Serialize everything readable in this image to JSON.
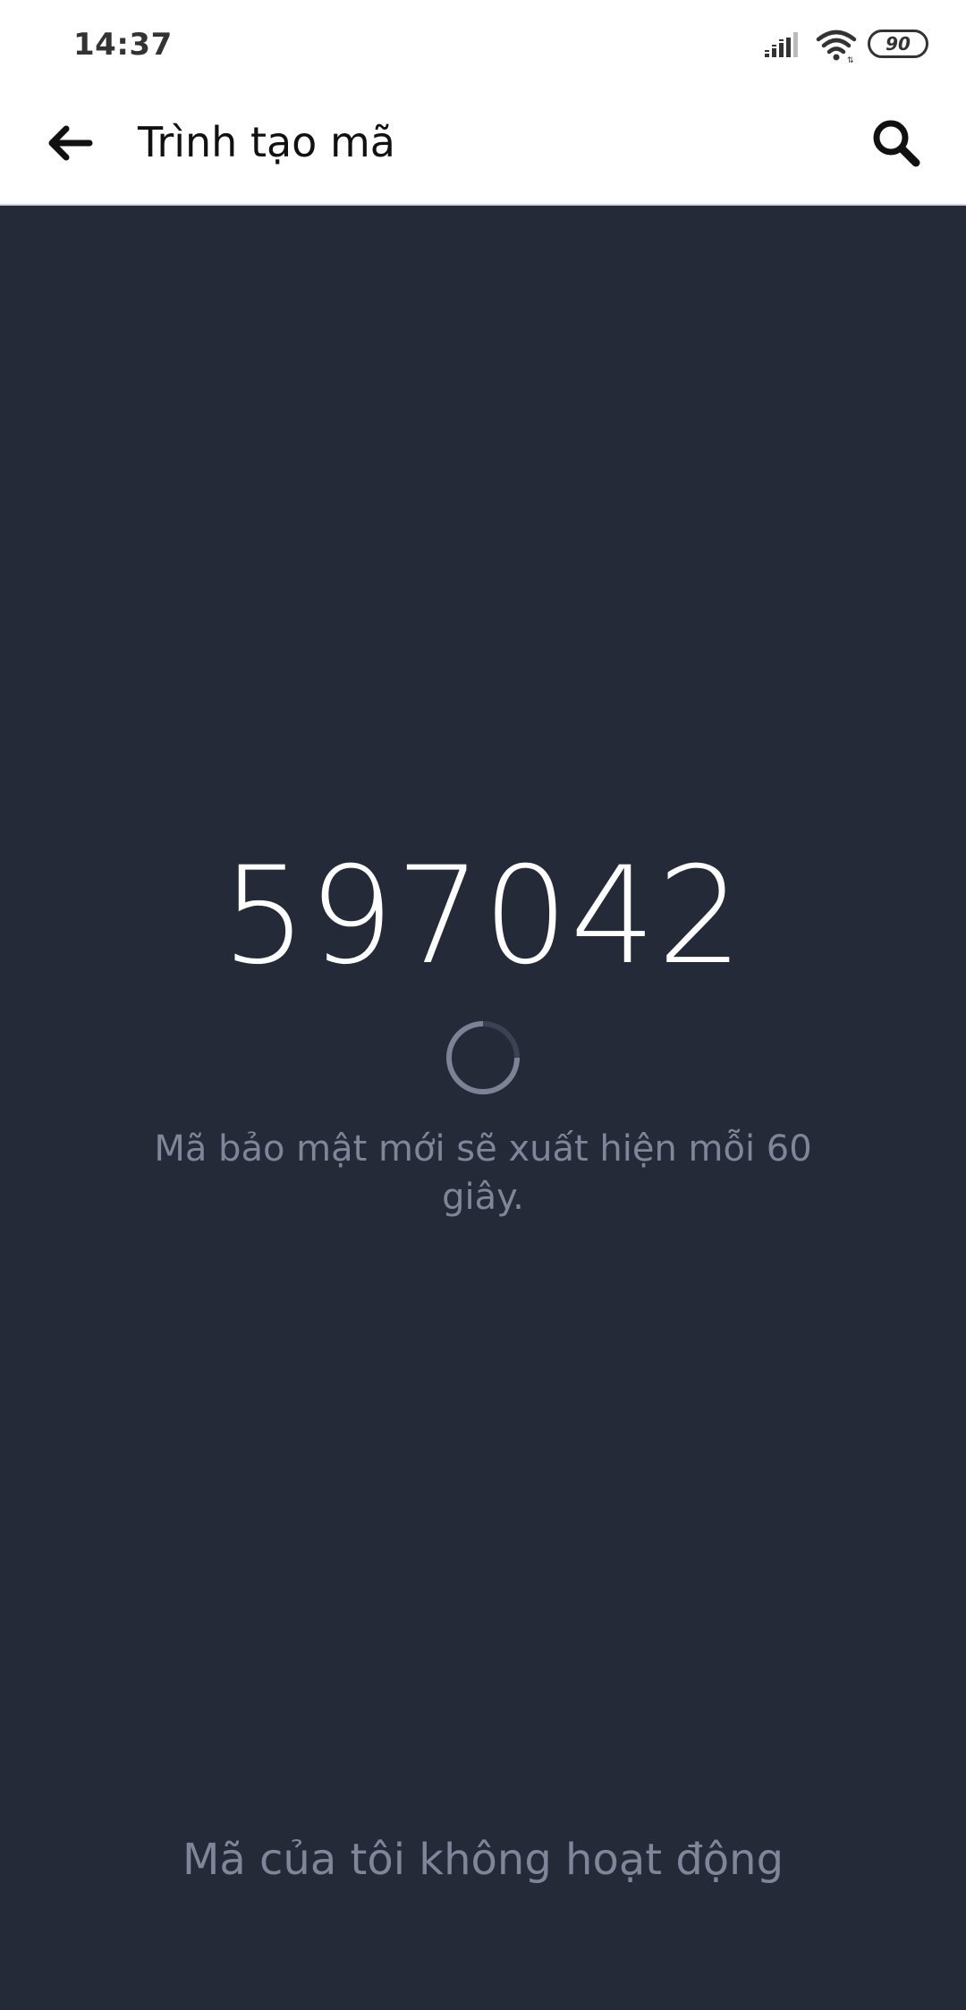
{
  "status_bar": {
    "time": "14:37",
    "battery": "90",
    "icons": [
      "signal-icon",
      "wifi-icon",
      "battery-icon"
    ]
  },
  "toolbar": {
    "title": "Trình tạo mã",
    "back_icon": "arrow-left-icon",
    "search_icon": "search-icon"
  },
  "code_generator": {
    "code": "597042",
    "info": "Mã bảo mật mới sẽ xuất hiện mỗi 60 giây.",
    "timer_icon": "countdown-spinner-icon"
  },
  "footer": {
    "code_not_working_label": "Mã của tôi không hoạt động"
  },
  "colors": {
    "background": "#252a38",
    "toolbar_background": "#ffffff",
    "code_text": "#ffffff",
    "secondary_text": "#80869a",
    "spinner_track": "#3c4254",
    "spinner_progress": "#7d8396"
  }
}
